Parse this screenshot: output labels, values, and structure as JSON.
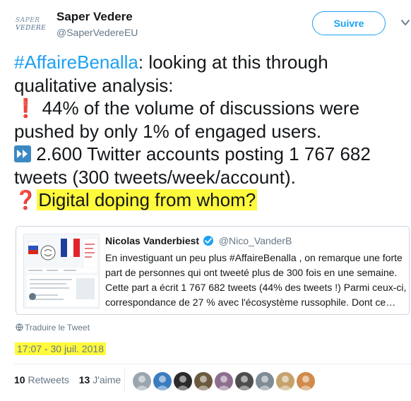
{
  "author": {
    "logo_line1": "SAPER",
    "logo_line2": "VEDERE",
    "name": "Saper Vedere",
    "handle": "@SaperVedereEU"
  },
  "follow_button": {
    "label": "Suivre"
  },
  "tweet": {
    "l1_hashtag": "#AffaireBenalla",
    "l1_rest": ": looking at this through",
    "l2": "qualitative analysis:",
    "l3_emoji": "❗",
    "l3": " 44% of the volume of discussions were",
    "l4": "pushed by only 1% of engaged users.",
    "l5": " 2.600 Twitter accounts posting 1 767 682",
    "l6": "tweets (300 tweets/week/account).",
    "l7_emoji": "❓",
    "l7": "Digital doping from whom?"
  },
  "quoted": {
    "name": "Nicolas Vanderbiest",
    "handle": "@Nico_VanderB",
    "lines": [
      "En investiguant un peu plus #AffaireBenalla , on remarque une forte",
      "part de personnes qui ont tweeté plus de 300 fois en une semaine.",
      "Cette part a écrit 1 767 682 tweets (44% des tweets !) Parmi ceux-ci,",
      "correspondance de 27 % avec l'écosystème russophile. Dont ce…"
    ]
  },
  "translate_label": "Traduire le Tweet",
  "timestamp": "17:07 - 30 juil. 2018",
  "stats": {
    "retweets_count": "10",
    "retweets_label": "Retweets",
    "likes_count": "13",
    "likes_label": "J'aime"
  },
  "colors": {
    "accent": "#1da1f2",
    "highlight": "#fffa3c",
    "muted": "#657786"
  },
  "avatar_colors": [
    "#9aa5ae",
    "#3a7dbf",
    "#2b2b2b",
    "#6b5a3d",
    "#8d6e8f",
    "#4d4d4d",
    "#7d8c95",
    "#c5a26b",
    "#d08a4a"
  ]
}
